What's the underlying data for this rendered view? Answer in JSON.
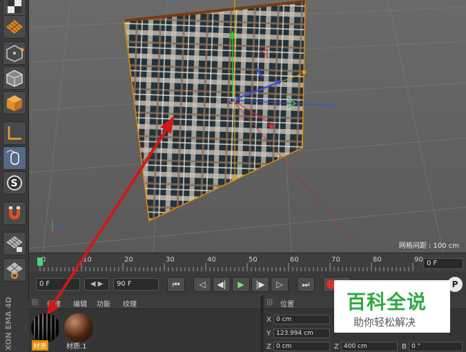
{
  "viewport": {
    "grid_info": "网格间距 : 100 cm"
  },
  "timeline": {
    "ticks": [
      "0",
      "10",
      "20",
      "30",
      "40",
      "50",
      "60",
      "70",
      "80",
      "90"
    ],
    "current_frame": "0 F"
  },
  "transport": {
    "start_frame": "0 F",
    "end_frame": "90 F",
    "buttons": [
      {
        "name": "go-to-start",
        "glyph": "⏮"
      },
      {
        "name": "previous-key",
        "glyph": "◁"
      },
      {
        "name": "step-back",
        "glyph": "◀|"
      },
      {
        "name": "play-forward",
        "glyph": "▶"
      },
      {
        "name": "step-forward",
        "glyph": "|▶"
      },
      {
        "name": "next-key",
        "glyph": "▷"
      },
      {
        "name": "go-to-end",
        "glyph": "⏭"
      }
    ],
    "step_arrows": "◀ ▶"
  },
  "material_manager": {
    "menu": [
      "创建",
      "编辑",
      "功能",
      "纹理"
    ],
    "materials": [
      {
        "label": "材质",
        "selected": true
      },
      {
        "label": "材质.1",
        "selected": false
      }
    ]
  },
  "attributes": {
    "header": "位置",
    "rows": [
      {
        "axis": "X",
        "value": "0 cm"
      },
      {
        "axis": "Y",
        "value": "123.994 cm"
      },
      {
        "axis": "Z",
        "value": "0 cm"
      }
    ],
    "size_z_label": "Z",
    "size_z_value": "400 cm",
    "rot_b_label": "B",
    "rot_b_value": "0 °"
  },
  "brand": {
    "vertical_text": "XON EMA 4D"
  },
  "watermark": {
    "title": "百科全说",
    "subtitle": "助你轻松解决"
  },
  "colors": {
    "arrow": "#d01818",
    "axis_x": "#e03030",
    "axis_y": "#30d030",
    "axis_z": "#3050e0",
    "selection": "#e68a00"
  }
}
